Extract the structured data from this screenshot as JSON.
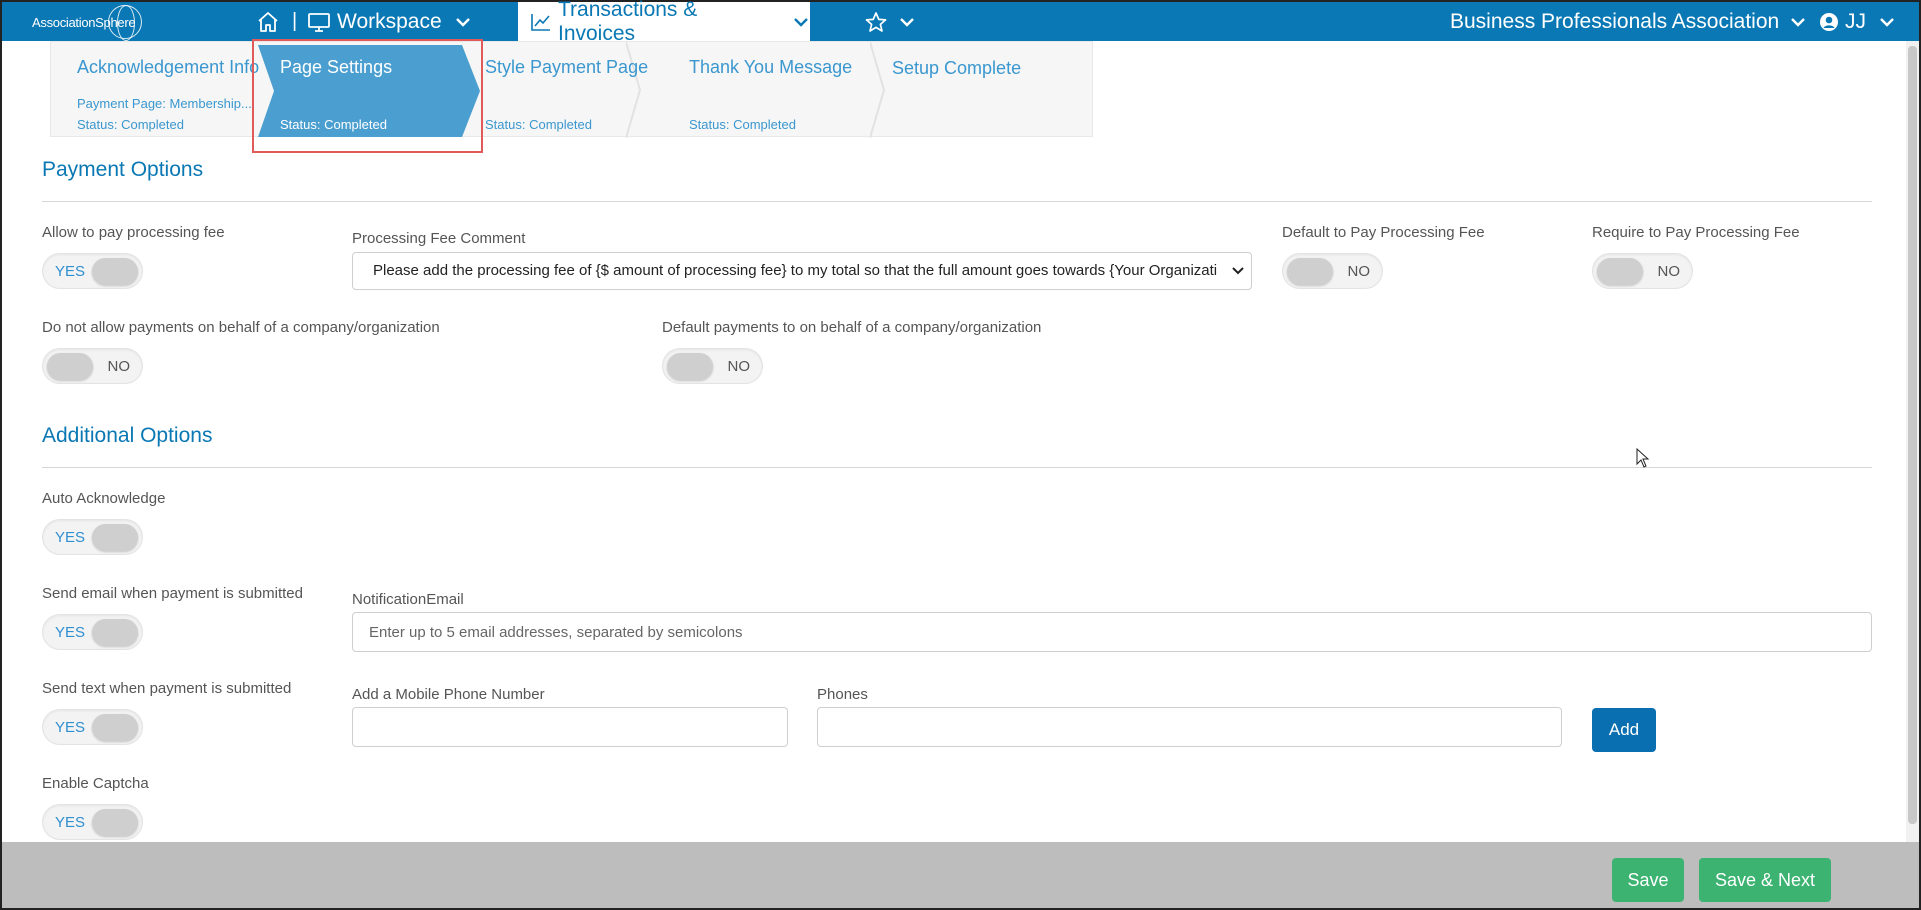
{
  "app": {
    "logo_text": "AssociationSphere"
  },
  "nav": {
    "separator": "|",
    "workspace": "Workspace",
    "transactions": "Transactions & Invoices",
    "organization": "Business Professionals Association",
    "user_initials": "JJ"
  },
  "steps": [
    {
      "title": "Acknowledgement Info",
      "sub": "Payment Page: Membership...",
      "status": "Status: Completed"
    },
    {
      "title": "Page Settings",
      "status": "Status: Completed",
      "active": true
    },
    {
      "title": "Style Payment Page",
      "status": "Status: Completed"
    },
    {
      "title": "Thank You Message",
      "status": "Status: Completed"
    },
    {
      "title": "Setup Complete"
    }
  ],
  "payment_options": {
    "title": "Payment Options",
    "allow_processing_fee": {
      "label": "Allow to pay processing fee",
      "value": "YES"
    },
    "processing_fee_comment": {
      "label": "Processing Fee Comment",
      "value": "Please add the processing fee of {$ amount of processing fee} to my total so that the full amount goes towards {Your Organizati"
    },
    "default_processing_fee": {
      "label": "Default to Pay Processing Fee",
      "value": "NO"
    },
    "require_processing_fee": {
      "label": "Require to Pay Processing Fee",
      "value": "NO"
    },
    "no_behalf_company": {
      "label": "Do not allow payments on behalf of a company/organization",
      "value": "NO"
    },
    "default_behalf_company": {
      "label": "Default payments to on behalf of a company/organization",
      "value": "NO"
    }
  },
  "additional_options": {
    "title": "Additional Options",
    "auto_acknowledge": {
      "label": "Auto Acknowledge",
      "value": "YES"
    },
    "send_email": {
      "label": "Send email when payment is submitted",
      "value": "YES"
    },
    "notification_email": {
      "label": "NotificationEmail",
      "placeholder": "Enter up to 5 email addresses, separated by semicolons"
    },
    "send_text": {
      "label": "Send text when payment is submitted",
      "value": "YES"
    },
    "mobile_phone": {
      "label": "Add a Mobile Phone Number",
      "value": ""
    },
    "phones": {
      "label": "Phones",
      "value": ""
    },
    "add_button": "Add",
    "enable_captcha": {
      "label": "Enable Captcha",
      "value": "YES"
    }
  },
  "footer": {
    "save": "Save",
    "save_next": "Save & Next"
  },
  "colors": {
    "nav_blue": "#0a78b4",
    "step_active": "#4a9fd0",
    "highlight": "#e05a5a",
    "save_green": "#3cb371"
  }
}
